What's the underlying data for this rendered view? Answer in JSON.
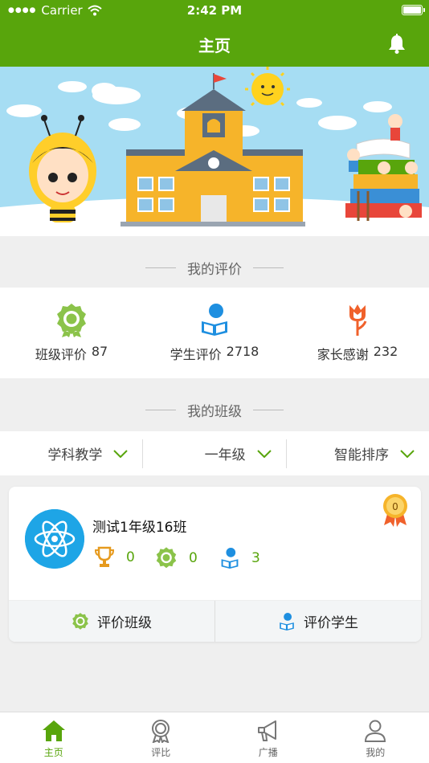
{
  "status_bar": {
    "carrier": "Carrier",
    "time": "2:42 PM"
  },
  "nav": {
    "title": "主页"
  },
  "sections": {
    "my_evaluation": "我的评价",
    "my_class": "我的班级"
  },
  "evaluations": [
    {
      "label": "班级评价",
      "count": "87",
      "icon": "medal-icon"
    },
    {
      "label": "学生评价",
      "count": "2718",
      "icon": "student-reading-icon"
    },
    {
      "label": "家长感谢",
      "count": "232",
      "icon": "tulip-icon"
    }
  ],
  "filters": [
    {
      "label": "学科教学"
    },
    {
      "label": "一年级"
    },
    {
      "label": "智能排序"
    }
  ],
  "class_card": {
    "name": "测试1年级16班",
    "badge": "0",
    "stats": [
      {
        "icon": "trophy-icon",
        "value": "0"
      },
      {
        "icon": "medal-icon",
        "value": "0"
      },
      {
        "icon": "student-reading-icon",
        "value": "3"
      }
    ],
    "actions": [
      {
        "label": "评价班级",
        "icon": "medal-icon"
      },
      {
        "label": "评价学生",
        "icon": "student-reading-icon"
      }
    ]
  },
  "tabs": [
    {
      "label": "主页",
      "icon": "home-icon",
      "active": true
    },
    {
      "label": "评比",
      "icon": "award-icon",
      "active": false
    },
    {
      "label": "广播",
      "icon": "megaphone-icon",
      "active": false
    },
    {
      "label": "我的",
      "icon": "person-icon",
      "active": false
    }
  ],
  "colors": {
    "brand": "#58a50c",
    "student_blue": "#1e8fe0",
    "tulip_orange": "#f0612b",
    "trophy_orange": "#e69a1e"
  }
}
